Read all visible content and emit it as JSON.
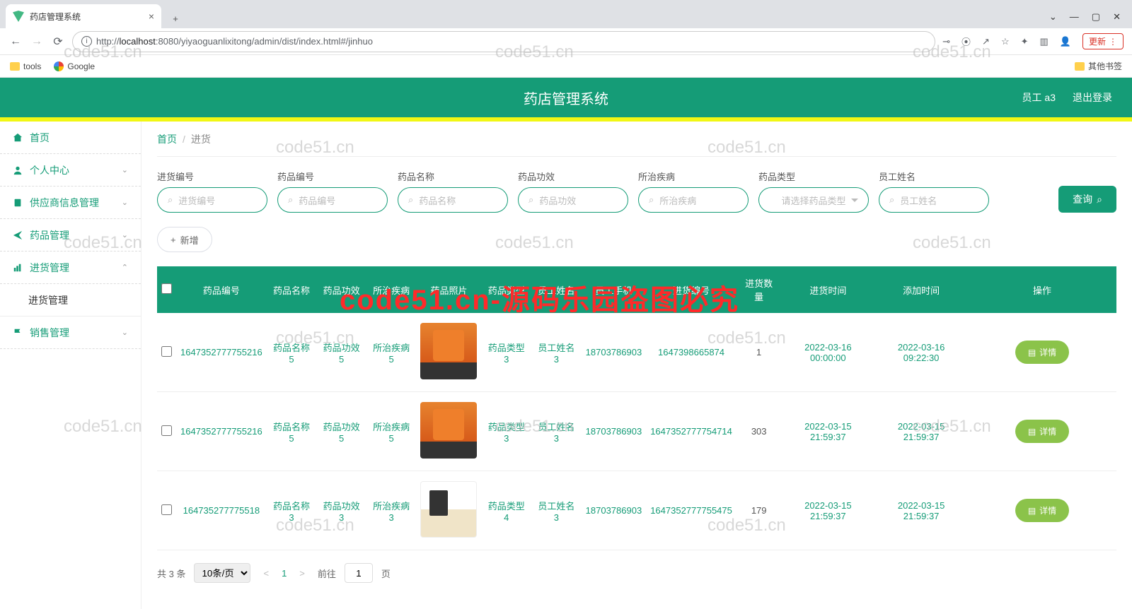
{
  "browser": {
    "tabTitle": "药店管理系统",
    "url_prefix": "http://",
    "url_host": "localhost",
    "url_path": ":8080/yiyaoguanlixitong/admin/dist/index.html#/jinhuo",
    "bookmarks": {
      "tools": "tools",
      "google": "Google",
      "other": "其他书签"
    },
    "updateLabel": "更新"
  },
  "header": {
    "title": "药店管理系统",
    "user": "员工 a3",
    "logout": "退出登录"
  },
  "sidebar": {
    "home": "首页",
    "personal": "个人中心",
    "supplier": "供应商信息管理",
    "medicine": "药品管理",
    "purchase": "进货管理",
    "purchaseSub": "进货管理",
    "sales": "销售管理"
  },
  "breadcrumb": {
    "home": "首页",
    "current": "进货"
  },
  "filters": {
    "f1": {
      "label": "进货编号",
      "ph": "进货编号"
    },
    "f2": {
      "label": "药品编号",
      "ph": "药品编号"
    },
    "f3": {
      "label": "药品名称",
      "ph": "药品名称"
    },
    "f4": {
      "label": "药品功效",
      "ph": "药品功效"
    },
    "f5": {
      "label": "所治疾病",
      "ph": "所治疾病"
    },
    "f6": {
      "label": "药品类型",
      "ph": "请选择药品类型"
    },
    "f7": {
      "label": "员工姓名",
      "ph": "员工姓名"
    },
    "queryBtn": "查询",
    "addBtn": "新增"
  },
  "table": {
    "headers": [
      "",
      "药品编号",
      "药品名称",
      "药品功效",
      "所治疾病",
      "药品照片",
      "药品类型",
      "员工姓名",
      "员工手机",
      "进货编号",
      "进货数量",
      "进货时间",
      "添加时间",
      "操作"
    ],
    "rows": [
      {
        "drugNo": "1647352777755216",
        "drugName": "药品名称5",
        "effect": "药品功效5",
        "disease": "所治疾病5",
        "type": "药品类型3",
        "staff": "员工姓名3",
        "phone": "18703786903",
        "purchaseNo": "1647398665874",
        "qty": "1",
        "purchaseTime": "2022-03-16 00:00:00",
        "addTime": "2022-03-16 09:22:30",
        "imgAlt": false
      },
      {
        "drugNo": "1647352777755216",
        "drugName": "药品名称5",
        "effect": "药品功效5",
        "disease": "所治疾病5",
        "type": "药品类型3",
        "staff": "员工姓名3",
        "phone": "18703786903",
        "purchaseNo": "1647352777754714",
        "qty": "303",
        "purchaseTime": "2022-03-15 21:59:37",
        "addTime": "2022-03-15 21:59:37",
        "imgAlt": false
      },
      {
        "drugNo": "164735277775518",
        "drugName": "药品名称3",
        "effect": "药品功效3",
        "disease": "所治疾病3",
        "type": "药品类型4",
        "staff": "员工姓名3",
        "phone": "18703786903",
        "purchaseNo": "1647352777755475",
        "qty": "179",
        "purchaseTime": "2022-03-15 21:59:37",
        "addTime": "2022-03-15 21:59:37",
        "imgAlt": true
      }
    ],
    "detailBtn": "详情"
  },
  "pager": {
    "total": "共 3 条",
    "pageSize": "10条/页",
    "page": "1",
    "goto": "前往",
    "pageSuffix": "页",
    "gotoVal": "1"
  },
  "watermark": {
    "text": "code51.cn",
    "big": "code51.cn-源码乐园盗图必究"
  }
}
